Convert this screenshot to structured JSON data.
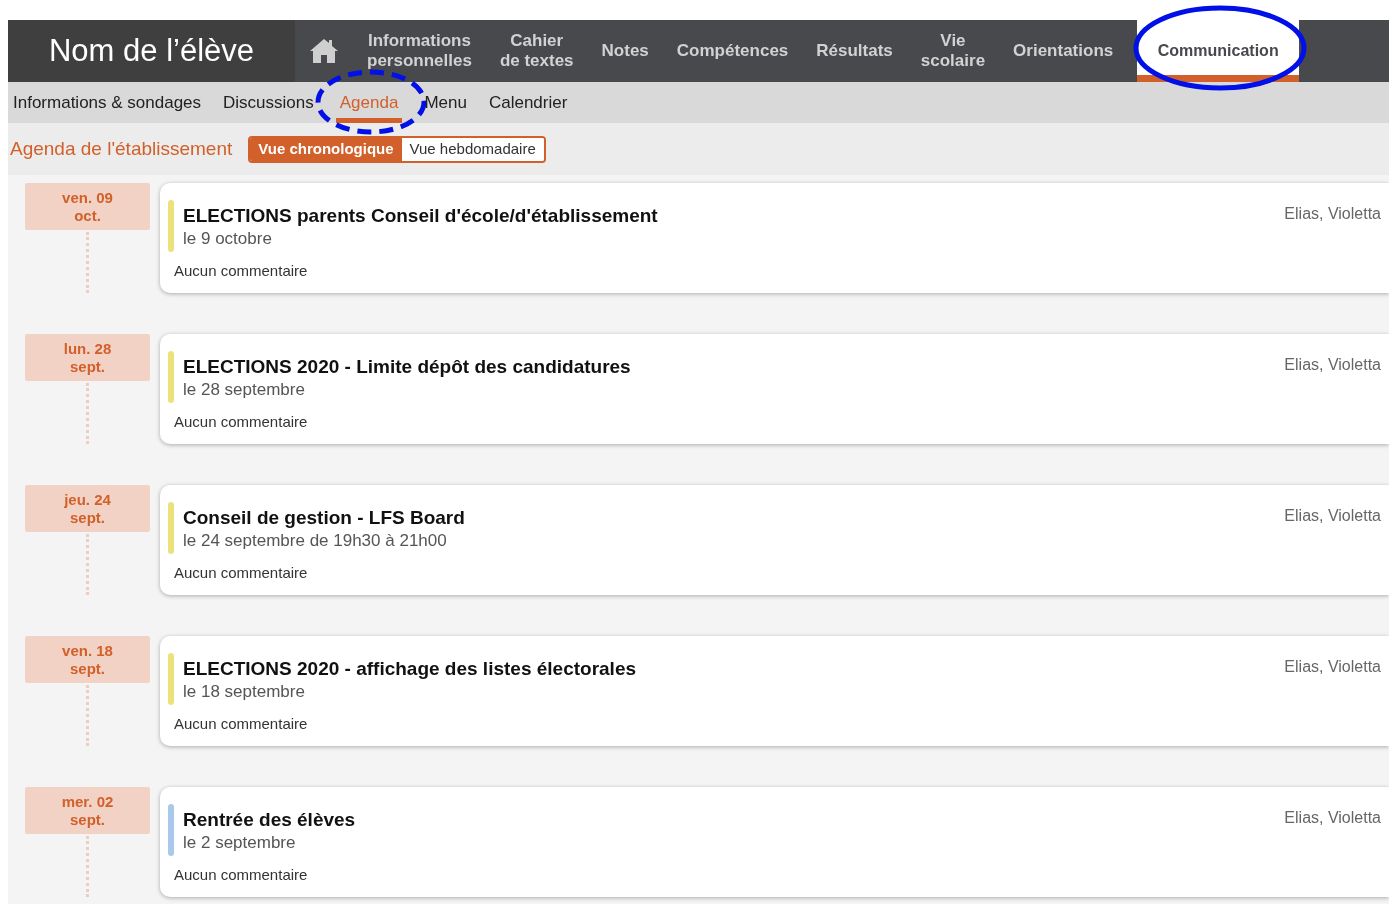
{
  "student_name": "Nom de l’élève",
  "main_nav": [
    {
      "label": "Informations\npersonnelles",
      "selected": false
    },
    {
      "label": "Cahier\nde textes",
      "selected": false
    },
    {
      "label": "Notes",
      "selected": false
    },
    {
      "label": "Compétences",
      "selected": false
    },
    {
      "label": "Résultats",
      "selected": false
    },
    {
      "label": "Vie\nscolaire",
      "selected": false
    },
    {
      "label": "Orientations",
      "selected": false
    },
    {
      "label": "Communication",
      "selected": true
    }
  ],
  "sub_nav": [
    {
      "label": "Informations & sondages",
      "selected": false
    },
    {
      "label": "Discussions",
      "selected": false
    },
    {
      "label": "Agenda",
      "selected": true
    },
    {
      "label": "Menu",
      "selected": false
    },
    {
      "label": "Calendrier",
      "selected": false
    }
  ],
  "page_title": "Agenda de l'établissement",
  "view_toggle": [
    {
      "label": "Vue chronologique",
      "selected": true
    },
    {
      "label": "Vue hebdomadaire",
      "selected": false
    }
  ],
  "events": [
    {
      "day": "ven. 09",
      "month": "oct.",
      "title": "ELECTIONS parents Conseil d'école/d'établissement",
      "when": "le 9 octobre",
      "comment": "Aucun commentaire",
      "audience": "Elias, Violetta",
      "color": "#ece27c"
    },
    {
      "day": "lun. 28",
      "month": "sept.",
      "title": "ELECTIONS 2020 - Limite dépôt des candidatures",
      "when": "le 28 septembre",
      "comment": "Aucun commentaire",
      "audience": "Elias, Violetta",
      "color": "#ece27c"
    },
    {
      "day": "jeu. 24",
      "month": "sept.",
      "title": "Conseil de gestion - LFS Board",
      "when": "le 24 septembre de 19h30 à 21h00",
      "comment": "Aucun commentaire",
      "audience": "Elias, Violetta",
      "color": "#ece27c"
    },
    {
      "day": "ven. 18",
      "month": "sept.",
      "title": "ELECTIONS 2020 - affichage des listes électorales",
      "when": "le 18 septembre",
      "comment": "Aucun commentaire",
      "audience": "Elias, Violetta",
      "color": "#ece27c"
    },
    {
      "day": "mer. 02",
      "month": "sept.",
      "title": "Rentrée des élèves",
      "when": "le 2 septembre",
      "comment": "Aucun commentaire",
      "audience": "Elias, Violetta",
      "color": "#a9c9ec"
    }
  ]
}
